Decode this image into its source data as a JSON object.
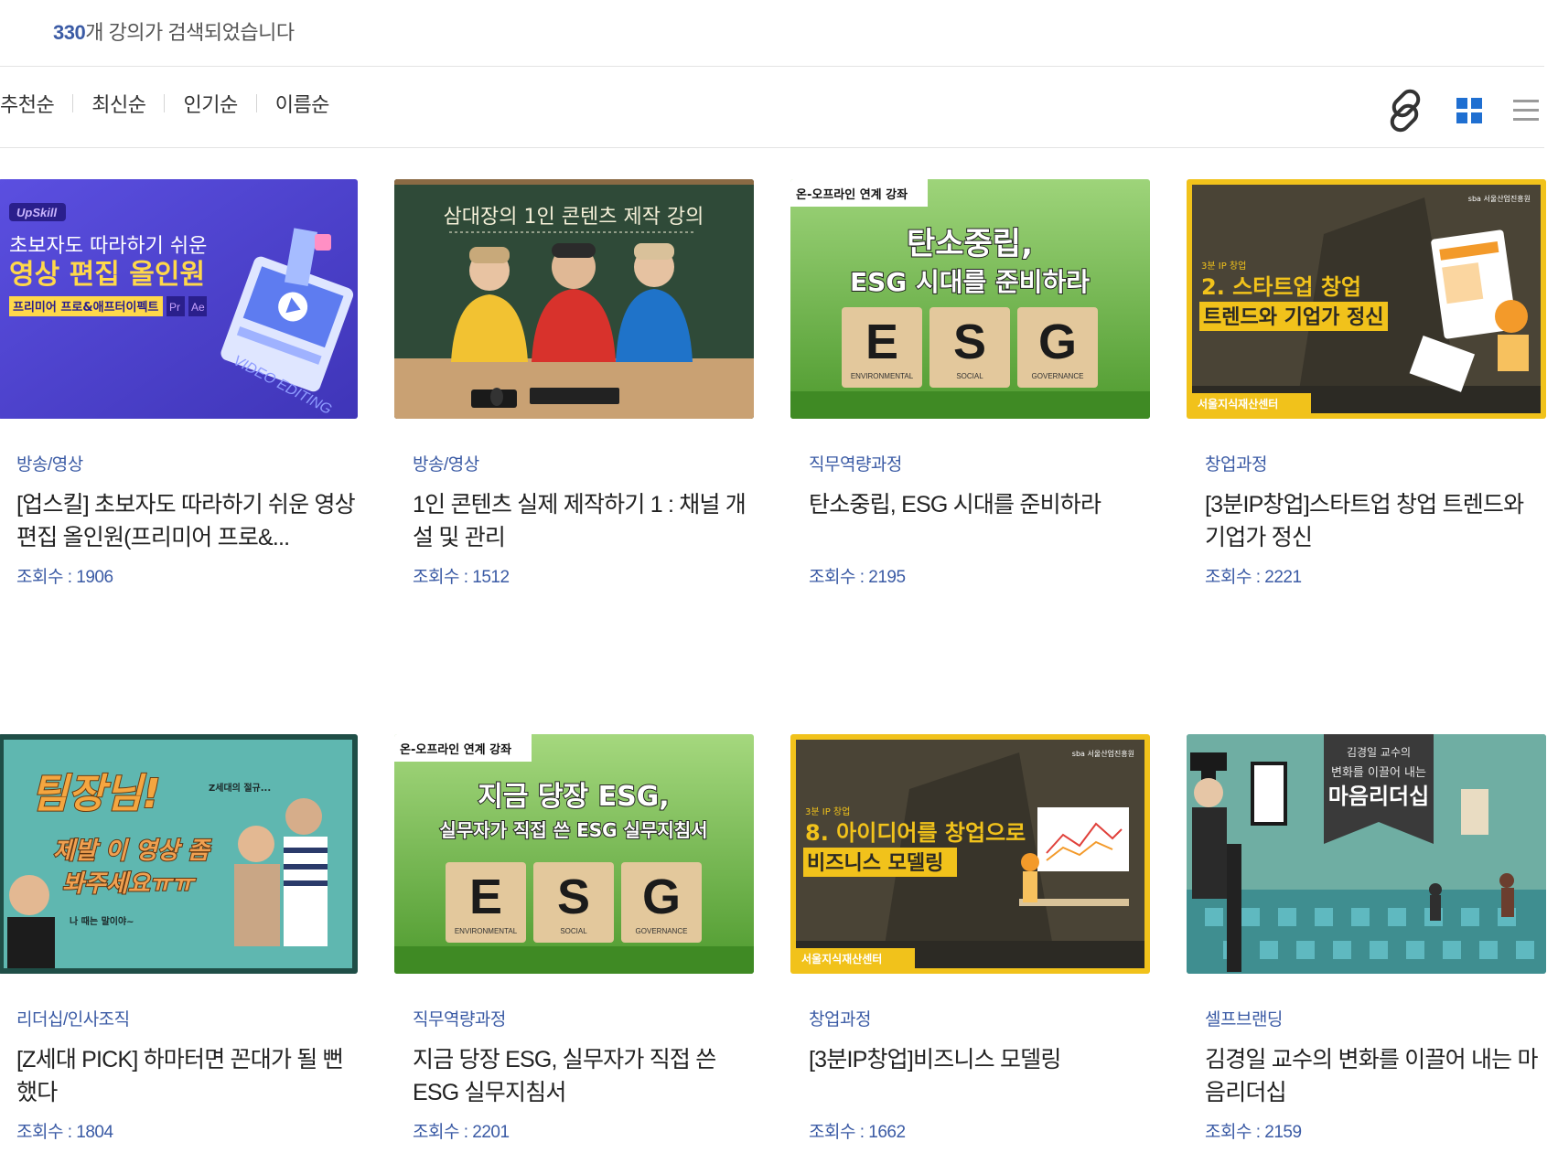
{
  "result": {
    "count": "330",
    "suffix": "개 강의가 검색되었습니다"
  },
  "sort_options": [
    "추천순",
    "최신순",
    "인기순",
    "이름순"
  ],
  "view_tools": {
    "link": "link-icon",
    "grid": "grid-view-icon",
    "list": "list-view-icon"
  },
  "colors": {
    "accent": "#3b5ba5",
    "grid_icon": "#1f6fd1",
    "muted_icon": "#9a9a9a"
  },
  "courses": [
    {
      "category": "방송/영상",
      "title": "[업스킬] 초보자도 따라하기 쉬운 영상 편집 올인원(프리미어 프로&...",
      "views": "조회수 : 1906",
      "thumb": {
        "badge": "UpSkill",
        "line1": "초보자도 따라하기 쉬운",
        "line2": "영상 편집 올인원",
        "line3": "프리미어 프로&애프터이펙트",
        "side": "VIDEO EDITING"
      }
    },
    {
      "category": "방송/영상",
      "title": "1인 콘텐츠 실제 제작하기 1 : 채널 개설 및 관리",
      "views": "조회수 : 1512",
      "thumb": {
        "line1": "삼대장의 1인 콘텐츠 제작 강의"
      }
    },
    {
      "category": "직무역량과정",
      "title": "탄소중립, ESG 시대를 준비하라",
      "views": "조회수 : 2195",
      "thumb": {
        "tag": "온-오프라인 연계 강좌",
        "line1": "탄소중립,",
        "line2": "ESG 시대를 준비하라",
        "e": "E",
        "s": "S",
        "g": "G",
        "e_sub": "ENVIRONMENTAL",
        "s_sub": "SOCIAL",
        "g_sub": "GOVERNANCE"
      }
    },
    {
      "category": "창업과정",
      "title": "[3분IP창업]스타트업 창업 트렌드와 기업가 정신",
      "views": "조회수 : 2221",
      "thumb": {
        "small": "3분 IP 창업",
        "line1": "2. 스타트업 창업",
        "line2": "트렌드와 기업가 정신",
        "footer": "서울지식재산센터",
        "logo": "sba 서울산업진흥원"
      }
    },
    {
      "category": "리더십/인사조직",
      "title": "[Z세대 PICK] 하마터면 꼰대가 될 뻔했다",
      "views": "조회수 : 1804",
      "thumb": {
        "line1": "팀장님!",
        "line2": "제발 이 영상 좀",
        "line3": "봐주세요ㅠㅠ",
        "small": "Z세대의 절규...",
        "caption": "나 때는 말이야~"
      }
    },
    {
      "category": "직무역량과정",
      "title": "지금 당장 ESG, 실무자가 직접 쓴 ESG 실무지침서",
      "views": "조회수 : 2201",
      "thumb": {
        "tag": "온-오프라인 연계 강좌",
        "line1": "지금 당장 ESG,",
        "line2": "실무자가 직접 쓴 ESG 실무지침서",
        "e": "E",
        "s": "S",
        "g": "G",
        "e_sub": "ENVIRONMENTAL",
        "s_sub": "SOCIAL",
        "g_sub": "GOVERNANCE"
      }
    },
    {
      "category": "창업과정",
      "title": "[3분IP창업]비즈니스 모델링",
      "views": "조회수 : 1662",
      "thumb": {
        "small": "3분 IP 창업",
        "line1": "8. 아이디어를 창업으로",
        "line2": "비즈니스 모델링",
        "footer": "서울지식재산센터",
        "logo": "sba 서울산업진흥원"
      }
    },
    {
      "category": "셀프브랜딩",
      "title": "김경일 교수의 변화를 이끌어 내는 마음리더십",
      "views": "조회수 : 2159",
      "thumb": {
        "line1": "김경일 교수의",
        "line2": "변화를 이끌어 내는",
        "line3": "마음리더십"
      }
    }
  ]
}
